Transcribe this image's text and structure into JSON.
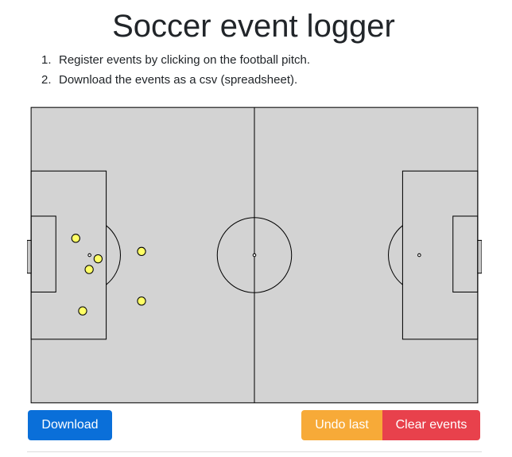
{
  "header": {
    "title": "Soccer event logger"
  },
  "instructions": [
    {
      "num": "1.",
      "text": "Register events by clicking on the football pitch."
    },
    {
      "num": "2.",
      "text": "Download the events as a csv (spreadsheet)."
    }
  ],
  "pitch": {
    "field_color": "#d3d3d3",
    "line_color": "#000000",
    "marker_color": "#ffff66",
    "events": [
      {
        "x": 11.0,
        "y": 31.9
      },
      {
        "x": 16.5,
        "y": 36.9
      },
      {
        "x": 14.3,
        "y": 39.5
      },
      {
        "x": 27.2,
        "y": 35.1
      },
      {
        "x": 27.2,
        "y": 47.2
      },
      {
        "x": 12.7,
        "y": 49.6
      }
    ]
  },
  "actions": {
    "download_label": "Download",
    "undo_label": "Undo last",
    "clear_label": "Clear events"
  },
  "colors": {
    "download": "#0a6fd9",
    "undo": "#f7aa38",
    "clear": "#e8414c"
  }
}
